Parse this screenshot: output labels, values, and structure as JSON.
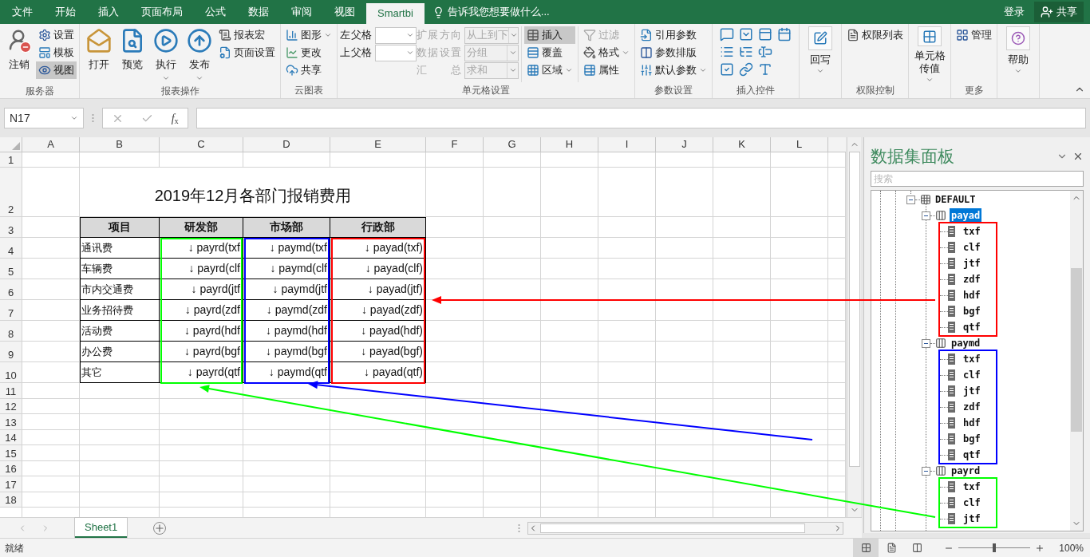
{
  "tabs": [
    {
      "label": "文件",
      "selected": false
    },
    {
      "label": "开始",
      "selected": false
    },
    {
      "label": "插入",
      "selected": false
    },
    {
      "label": "页面布局",
      "selected": false
    },
    {
      "label": "公式",
      "selected": false
    },
    {
      "label": "数据",
      "selected": false
    },
    {
      "label": "审阅",
      "selected": false
    },
    {
      "label": "视图",
      "selected": false
    },
    {
      "label": "Smartbi",
      "selected": true
    }
  ],
  "tell_me": "告诉我您想要做什么...",
  "account": {
    "sign_in": "登录",
    "share": "共享"
  },
  "ribbon": [
    {
      "kind": "buttons",
      "label": "服务器",
      "columns": [
        [
          {
            "kind": "large",
            "label": "注销"
          }
        ],
        [
          {
            "kind": "small",
            "label": "设置",
            "selected": false
          },
          {
            "kind": "small",
            "label": "模板",
            "selected": false
          },
          {
            "kind": "small",
            "label": "视图",
            "selected": true
          }
        ]
      ]
    },
    {
      "kind": "buttons",
      "label": "报表操作",
      "columns": [
        [
          {
            "kind": "large",
            "label": "打开"
          }
        ],
        [
          {
            "kind": "large",
            "label": "预览"
          }
        ],
        [
          {
            "kind": "large",
            "label": "执行",
            "dropdown": true
          }
        ],
        [
          {
            "kind": "large",
            "label": "发布",
            "dropdown": true
          }
        ],
        [
          {
            "kind": "small",
            "label": "报表宏",
            "selected": false
          },
          {
            "kind": "small",
            "label": "页面设置",
            "selected": false
          }
        ]
      ]
    },
    {
      "kind": "buttons",
      "label": "云图表",
      "columns": [
        [
          {
            "kind": "small",
            "label": "图形",
            "selected": false,
            "dropdown": true
          },
          {
            "kind": "small",
            "label": "更改",
            "selected": false
          },
          {
            "kind": "small",
            "label": "共享",
            "selected": false
          }
        ]
      ]
    },
    {
      "kind": "buttons",
      "label": "单元格设置",
      "columns": [
        [
          {
            "kind": "combo",
            "label": "左父格"
          },
          {
            "kind": "combo",
            "label": "上父格"
          }
        ],
        [
          {
            "kind": "combo",
            "label": "扩展方向",
            "value": "从上到下",
            "disabled": true
          },
          {
            "kind": "combo",
            "label": "数据设置",
            "value": "分组",
            "disabled": true
          },
          {
            "kind": "combo",
            "label": "汇总",
            "value": "求和",
            "disabled": true
          }
        ],
        [
          {
            "kind": "small",
            "label": "插入",
            "selected": true
          },
          {
            "kind": "small",
            "label": "覆盖",
            "selected": false
          },
          {
            "kind": "small",
            "label": "区域",
            "selected": false,
            "dropdown": true
          }
        ],
        [
          {
            "kind": "small",
            "label": "过滤",
            "selected": false,
            "disabled": true
          },
          {
            "kind": "small",
            "label": "格式",
            "selected": false,
            "dropdown": true
          },
          {
            "kind": "small",
            "label": "属性",
            "selected": false
          }
        ]
      ]
    },
    {
      "kind": "buttons",
      "label": "参数设置",
      "columns": [
        [
          {
            "kind": "small",
            "label": "引用参数",
            "selected": false
          },
          {
            "kind": "small",
            "label": "参数排版",
            "selected": false
          },
          {
            "kind": "small",
            "label": "默认参数",
            "selected": false,
            "dropdown": true
          }
        ]
      ]
    },
    {
      "kind": "controls",
      "label": "插入控件"
    },
    {
      "kind": "buttons",
      "columns": [
        [
          {
            "kind": "tile",
            "label": "回写",
            "dropdown": true
          }
        ]
      ]
    },
    {
      "kind": "buttons",
      "label": "权限控制",
      "columns": [
        [
          {
            "kind": "small",
            "label": "权限列表",
            "selected": false
          }
        ]
      ]
    },
    {
      "kind": "buttons",
      "columns": [
        [
          {
            "kind": "tile",
            "label": "单元格传值",
            "dropdown": true
          }
        ]
      ]
    },
    {
      "kind": "buttons",
      "label": "更多",
      "columns": [
        [
          {
            "kind": "small",
            "label": "管理",
            "selected": false
          }
        ]
      ]
    },
    {
      "kind": "buttons",
      "columns": [
        [
          {
            "kind": "tile",
            "label": "帮助",
            "dropdown": true
          }
        ]
      ]
    }
  ],
  "formula_bar": {
    "name_box": "N17",
    "fx": "*f*$_{x}$"
  },
  "sheet": {
    "columns": [
      "A",
      "B",
      "C",
      "D",
      "E",
      "F",
      "G",
      "H",
      "I",
      "J",
      "K",
      "L"
    ],
    "rows": [
      "1",
      "2",
      "3",
      "4",
      "5",
      "6",
      "7",
      "8",
      "9",
      "10",
      "11",
      "12",
      "13",
      "14",
      "15",
      "16",
      "17",
      "18"
    ],
    "title": "2019年12月各部门报销费用",
    "table": {
      "header": "项目",
      "departments": [
        {
          "label": "研发部",
          "color": "#00ff00"
        },
        {
          "label": "市场部",
          "color": "#0000ff"
        },
        {
          "label": "行政部",
          "color": "#ff0000"
        }
      ],
      "rows": [
        {
          "item": "通讯费",
          "values": [
            "↓ payrd(txf",
            "↓ paymd(txf",
            "↓ payad(txf)"
          ]
        },
        {
          "item": "车辆费",
          "values": [
            "↓ payrd(clf",
            "↓ paymd(clf",
            "↓ payad(clf)"
          ]
        },
        {
          "item": "市内交通费",
          "values": [
            "↓ payrd(jtf",
            "↓ paymd(jtf",
            "↓ payad(jtf)"
          ]
        },
        {
          "item": "业务招待费",
          "values": [
            "↓ payrd(zdf",
            "↓ paymd(zdf",
            "↓ payad(zdf)"
          ]
        },
        {
          "item": "活动费",
          "values": [
            "↓ payrd(hdf",
            "↓ paymd(hdf",
            "↓ payad(hdf)"
          ]
        },
        {
          "item": "办公费",
          "values": [
            "↓ payrd(bgf",
            "↓ paymd(bgf",
            "↓ payad(bgf)"
          ]
        },
        {
          "item": "其它",
          "values": [
            "↓ payrd(qtf",
            "↓ paymd(qtf",
            "↓ payad(qtf)"
          ]
        }
      ]
    }
  },
  "arrows": [
    {
      "color": "#ff0000"
    },
    {
      "color": "#0000ff"
    },
    {
      "color": "#00ff00"
    }
  ],
  "sheet_tabs": [
    {
      "label": "Sheet1",
      "selected": true
    }
  ],
  "panel": {
    "title": "数据集面板",
    "search_placeholder": "搜索",
    "tree": {
      "label": "DEFAULT",
      "expanded": true,
      "children": [
        {
          "label": "payad",
          "selected": true,
          "expanded": true,
          "color": "#ff0000",
          "children": [
            {
              "label": "txf",
              "selected": false
            },
            {
              "label": "clf",
              "selected": false
            },
            {
              "label": "jtf",
              "selected": false
            },
            {
              "label": "zdf",
              "selected": false
            },
            {
              "label": "hdf",
              "selected": false
            },
            {
              "label": "bgf",
              "selected": false
            },
            {
              "label": "qtf",
              "selected": false
            }
          ]
        },
        {
          "label": "paymd",
          "selected": false,
          "expanded": true,
          "color": "#0000ff",
          "children": [
            {
              "label": "txf",
              "selected": false
            },
            {
              "label": "clf",
              "selected": false
            },
            {
              "label": "jtf",
              "selected": false
            },
            {
              "label": "zdf",
              "selected": false
            },
            {
              "label": "hdf",
              "selected": false
            },
            {
              "label": "bgf",
              "selected": false
            },
            {
              "label": "qtf",
              "selected": false
            }
          ]
        },
        {
          "label": "payrd",
          "selected": false,
          "expanded": true,
          "color": "#00ff00",
          "children": [
            {
              "label": "txf",
              "selected": false
            },
            {
              "label": "clf",
              "selected": false
            },
            {
              "label": "jtf",
              "selected": false
            }
          ]
        }
      ]
    }
  },
  "status": {
    "text": "就绪",
    "views": [
      {
        "selected": true
      },
      {
        "selected": false
      },
      {
        "selected": false
      }
    ],
    "zoom": {
      "level": 0.5,
      "reading": "100%"
    }
  }
}
